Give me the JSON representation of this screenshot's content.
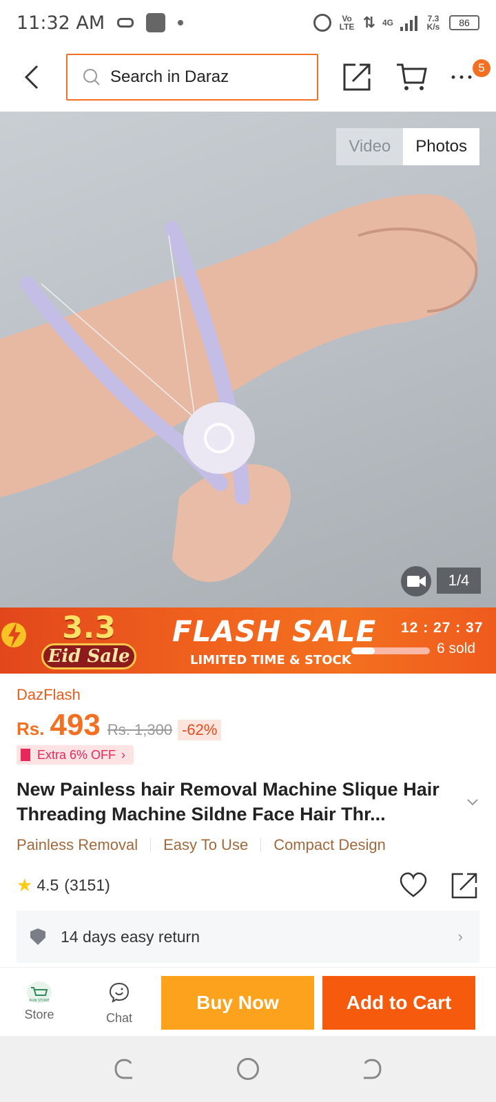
{
  "status_bar": {
    "time": "11:32 AM",
    "volte": "Vo LTE",
    "network": "4G",
    "speed": "7.3 K/s",
    "battery": "86"
  },
  "header": {
    "search_placeholder": "Search in Daraz",
    "more_badge": "5"
  },
  "gallery": {
    "video_tab": "Video",
    "photos_tab": "Photos",
    "counter": "1/4"
  },
  "flash_sale": {
    "badge_number": "3.3",
    "badge_label": "Eid Sale",
    "title": "FLASH SALE",
    "subtitle": "LIMITED TIME & STOCK",
    "countdown": "12 : 27 : 37",
    "sold": "6 sold",
    "sold_progress": 0.3
  },
  "product": {
    "store_tag": "DazFlash",
    "currency": "Rs.",
    "price": "493",
    "original_price": "Rs. 1,300",
    "discount": "-62%",
    "voucher": "Extra 6% OFF",
    "title": "New Painless hair Removal Machine Slique Hair Threading Machine Sildne Face Hair Thr...",
    "features": [
      "Painless Removal",
      "Easy To Use",
      "Compact Design"
    ],
    "rating": "4.5",
    "rating_count": "(3151)",
    "return_policy": "14 days easy return"
  },
  "bottom_bar": {
    "store_label": "Store",
    "store_logo_text": "RUN STORE",
    "chat_label": "Chat",
    "buy_now": "Buy Now",
    "add_to_cart": "Add to Cart"
  },
  "colors": {
    "brand": "#f36f21",
    "buy_now": "#fca21c",
    "add_to_cart": "#f55a0d"
  }
}
